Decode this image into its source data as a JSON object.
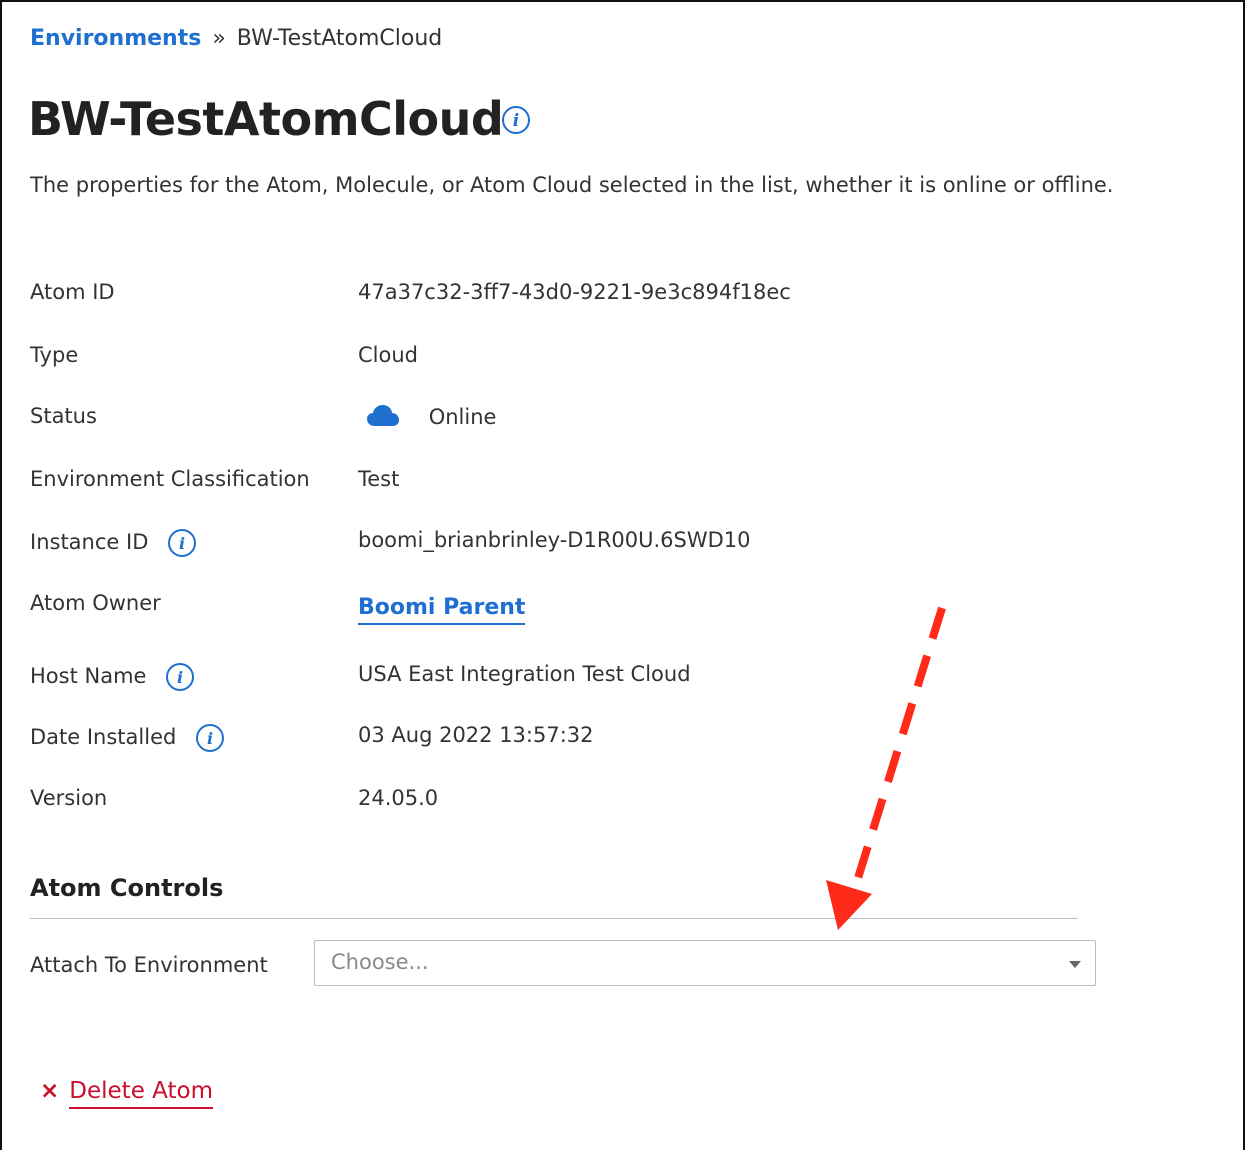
{
  "breadcrumb": {
    "root": "Environments",
    "separator": "»",
    "current": "BW-TestAtomCloud"
  },
  "page": {
    "title": "BW-TestAtomCloud",
    "description": "The properties for the Atom, Molecule, or Atom Cloud selected in the list, whether it is online or offline."
  },
  "properties": {
    "atom_id": {
      "label": "Atom ID",
      "value": "47a37c32-3ff7-43d0-9221-9e3c894f18ec"
    },
    "type": {
      "label": "Type",
      "value": "Cloud"
    },
    "status": {
      "label": "Status",
      "value": "Online",
      "icon": "cloud-icon"
    },
    "env_class": {
      "label": "Environment Classification",
      "value": "Test"
    },
    "instance_id": {
      "label": "Instance ID",
      "value": "boomi_brianbrinley-D1R00U.6SWD10"
    },
    "atom_owner": {
      "label": "Atom Owner",
      "value": "Boomi Parent"
    },
    "host_name": {
      "label": "Host Name",
      "value": "USA East Integration Test Cloud"
    },
    "date_installed": {
      "label": "Date Installed",
      "value": "03 Aug 2022 13:57:32"
    },
    "version": {
      "label": "Version",
      "value": "24.05.0"
    }
  },
  "controls": {
    "section_title": "Atom Controls",
    "attach_label": "Attach To Environment",
    "attach_placeholder": "Choose..."
  },
  "actions": {
    "delete_icon": "×",
    "delete_label": "Delete Atom"
  },
  "colors": {
    "link": "#1f6fd1",
    "danger": "#c8102e",
    "arrow": "#ff2a1a"
  }
}
